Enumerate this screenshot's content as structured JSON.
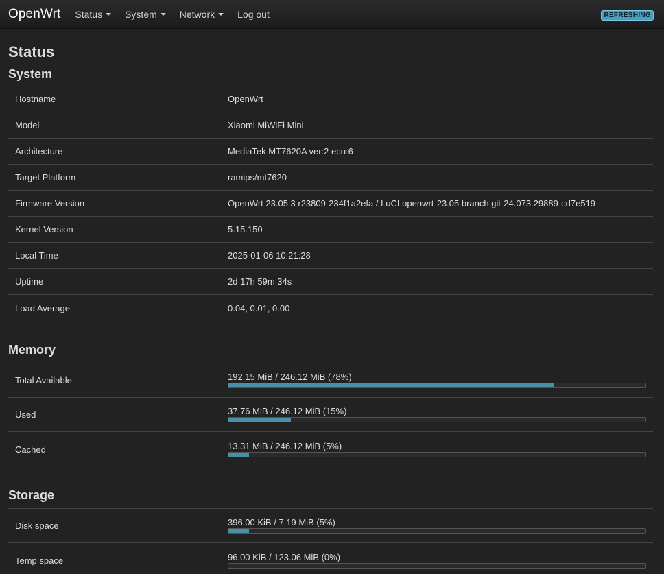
{
  "header": {
    "brand": "OpenWrt",
    "nav": [
      {
        "label": "Status",
        "dropdown": true
      },
      {
        "label": "System",
        "dropdown": true
      },
      {
        "label": "Network",
        "dropdown": true
      },
      {
        "label": "Log out",
        "dropdown": false
      }
    ],
    "badge": "REFRESHING"
  },
  "page": {
    "title": "Status"
  },
  "system": {
    "title": "System",
    "rows": [
      {
        "label": "Hostname",
        "value": "OpenWrt"
      },
      {
        "label": "Model",
        "value": "Xiaomi MiWiFi Mini"
      },
      {
        "label": "Architecture",
        "value": "MediaTek MT7620A ver:2 eco:6"
      },
      {
        "label": "Target Platform",
        "value": "ramips/mt7620"
      },
      {
        "label": "Firmware Version",
        "value": "OpenWrt 23.05.3 r23809-234f1a2efa / LuCI openwrt-23.05 branch git-24.073.29889-cd7e519"
      },
      {
        "label": "Kernel Version",
        "value": "5.15.150"
      },
      {
        "label": "Local Time",
        "value": "2025-01-06 10:21:28"
      },
      {
        "label": "Uptime",
        "value": "2d 17h 59m 34s"
      },
      {
        "label": "Load Average",
        "value": "0.04, 0.01, 0.00"
      }
    ]
  },
  "memory": {
    "title": "Memory",
    "rows": [
      {
        "label": "Total Available",
        "text": "192.15 MiB / 246.12 MiB (78%)",
        "percent": 78
      },
      {
        "label": "Used",
        "text": "37.76 MiB / 246.12 MiB (15%)",
        "percent": 15
      },
      {
        "label": "Cached",
        "text": "13.31 MiB / 246.12 MiB (5%)",
        "percent": 5
      }
    ]
  },
  "storage": {
    "title": "Storage",
    "rows": [
      {
        "label": "Disk space",
        "text": "396.00 KiB / 7.19 MiB (5%)",
        "percent": 5
      },
      {
        "label": "Temp space",
        "text": "96.00 KiB / 123.06 MiB (0%)",
        "percent": 0
      }
    ]
  },
  "colors": {
    "background": "#222222",
    "accent": "#4a8fa8",
    "badge": "#4a9fc0"
  }
}
